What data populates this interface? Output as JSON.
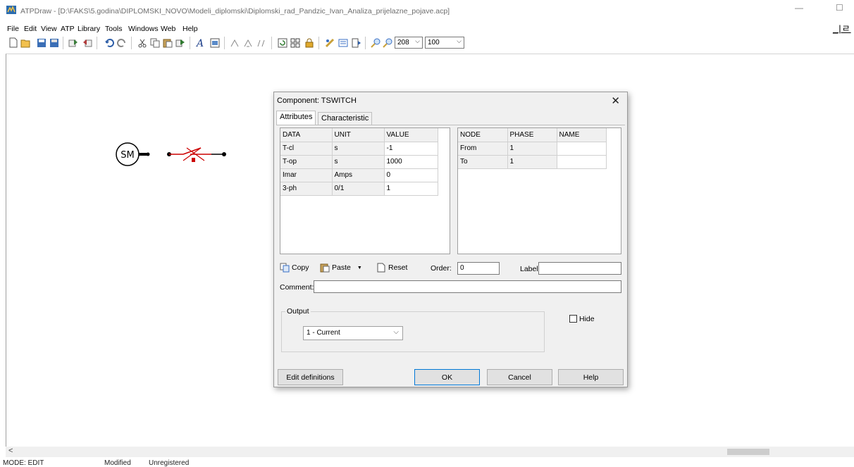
{
  "window": {
    "title": "ATPDraw - [D:\\FAKS\\5.godina\\DIPLOMSKI_NOVO\\Modeli_diplomski\\Diplomski_rad_Pandzic_Ivan_Analiza_prijelazne_pojave.acp]",
    "minimize": "—",
    "maximize": "☐",
    "mdi_controls": "_|ㄹ"
  },
  "menu": [
    "File",
    "Edit",
    "View",
    "ATP",
    "Library",
    "Tools",
    "Windows",
    "Web",
    "Help"
  ],
  "toolbar": {
    "zoom_value": "208",
    "grid_value": "100",
    "icons": [
      "new-icon",
      "open-icon",
      "save-icon",
      "save-all-icon",
      "import-icon",
      "export-icon",
      "undo-icon",
      "redo-icon",
      "cut-icon",
      "copy-icon",
      "paste-icon",
      "duplicate-icon",
      "text-icon",
      "image-icon",
      "rotate-icon",
      "flip-h-icon",
      "flip-v-icon",
      "refresh-icon",
      "select-all-icon",
      "lock-icon",
      "run-icon",
      "edit-icon",
      "output-icon",
      "zoom-in-icon",
      "zoom-out-icon"
    ]
  },
  "schematic": {
    "source_label": "SM"
  },
  "dialog": {
    "title": "Component: TSWITCH",
    "close": "✕",
    "tabs": [
      "Attributes",
      "Characteristic"
    ],
    "attributes": {
      "headers": [
        "DATA",
        "UNIT",
        "VALUE"
      ],
      "rows": [
        [
          "T-cl",
          "s",
          "-1"
        ],
        [
          "T-op",
          "s",
          "1000"
        ],
        [
          "Imar",
          "Amps",
          "0"
        ],
        [
          "3-ph",
          "0/1",
          "1"
        ]
      ]
    },
    "nodes": {
      "headers": [
        "NODE",
        "PHASE",
        "NAME"
      ],
      "rows": [
        [
          "From",
          "1",
          ""
        ],
        [
          "To",
          "1",
          ""
        ]
      ]
    },
    "copy_label": "Copy",
    "paste_label": "Paste",
    "paste_arrow": "▼",
    "reset_label": "Reset",
    "order_label": "Order:",
    "order_value": "0",
    "label_label": "Label:",
    "label_value": "",
    "comment_label": "Comment:",
    "comment_value": "",
    "output_label": "Output",
    "output_selected": "1 - Current",
    "hide_label": "Hide",
    "buttons": {
      "edit_definitions": "Edit definitions",
      "ok": "OK",
      "cancel": "Cancel",
      "help": "Help"
    }
  },
  "scroll": {
    "left_arrow": "<"
  },
  "status": {
    "mode": "MODE: EDIT",
    "modified": "Modified",
    "registration": "Unregistered"
  }
}
